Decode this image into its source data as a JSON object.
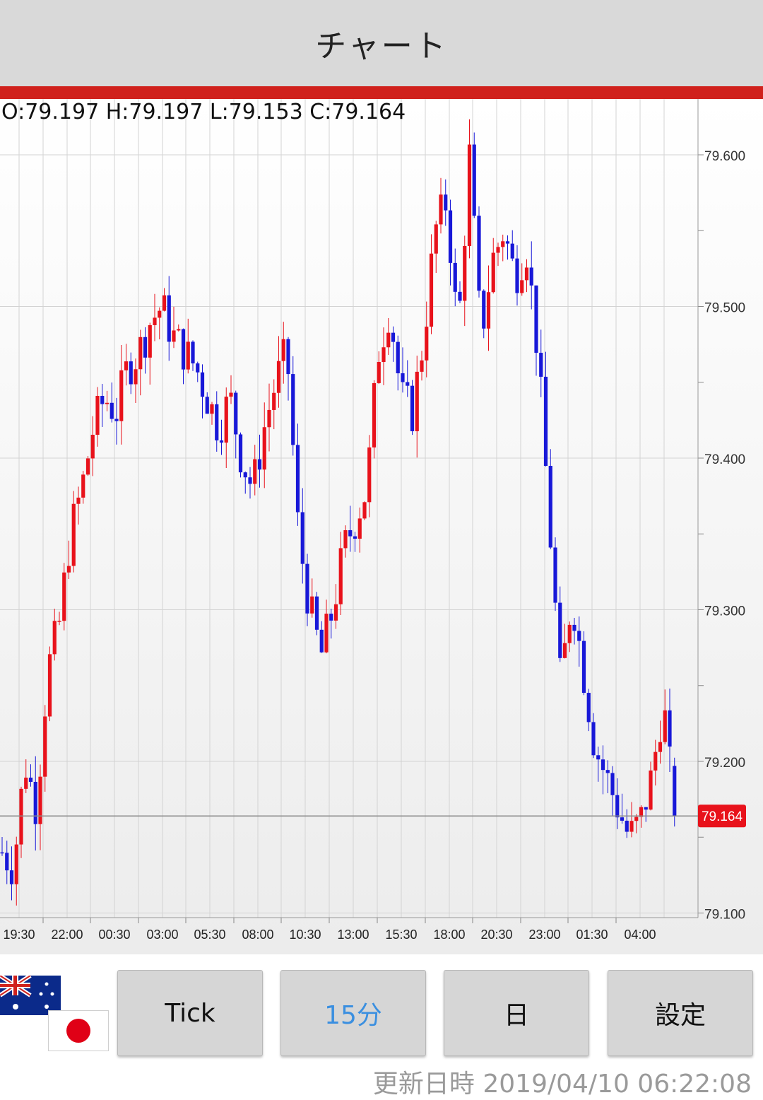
{
  "header": {
    "title": "チャート"
  },
  "ohlc": {
    "text": "O:79.197 H:79.197 L:79.153 C:79.164"
  },
  "current_price_label": "79.164",
  "buttons": {
    "tick": "Tick",
    "m15": "15分",
    "day": "日",
    "settings": "設定"
  },
  "updated": {
    "text": "更新日時 2019/04/10 06:22:08"
  },
  "colors": {
    "up": "#e8121b",
    "down": "#1818d8",
    "accent_red": "#d0211c",
    "active_blue": "#3a8fe0"
  },
  "icons": [
    "australia-flag-icon",
    "japan-flag-icon"
  ],
  "chart_data": {
    "type": "candlestick",
    "y_ticks": [
      79.6,
      79.5,
      79.4,
      79.3,
      79.2,
      79.1
    ],
    "ylim": [
      79.095,
      79.635
    ],
    "x_tick_labels": [
      "19:30",
      "22:00",
      "00:30",
      "03:00",
      "05:30",
      "08:00",
      "10:30",
      "13:00",
      "15:30",
      "18:00",
      "20:30",
      "23:00",
      "01:30",
      "04:00"
    ],
    "current_price": 79.164,
    "grid": true,
    "waypoints": [
      79.14,
      79.13,
      79.2,
      79.17,
      79.26,
      79.29,
      79.35,
      79.38,
      79.42,
      79.44,
      79.43,
      79.46,
      79.47,
      79.49,
      79.5,
      79.48,
      79.47,
      79.46,
      79.44,
      79.42,
      79.44,
      79.4,
      79.38,
      79.42,
      79.45,
      79.47,
      79.35,
      79.3,
      79.27,
      79.3,
      79.34,
      79.36,
      79.38,
      79.47,
      79.5,
      79.44,
      79.43,
      79.48,
      79.55,
      79.57,
      79.48,
      79.6,
      79.48,
      79.53,
      79.55,
      79.52,
      79.54,
      79.47,
      79.36,
      79.25,
      79.31,
      79.26,
      79.21,
      79.19,
      79.17,
      79.15,
      79.16,
      79.19,
      79.24,
      79.164
    ],
    "last_candle": {
      "open": 79.197,
      "high": 79.197,
      "low": 79.153,
      "close": 79.164
    }
  }
}
